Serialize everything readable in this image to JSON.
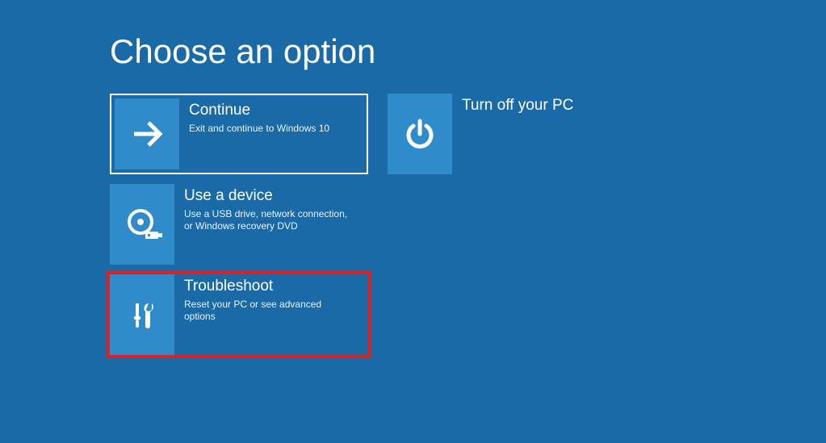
{
  "title": "Choose an option",
  "tiles": {
    "continue": {
      "title": "Continue",
      "desc": "Exit and continue to Windows 10"
    },
    "turn_off": {
      "title": "Turn off your PC",
      "desc": ""
    },
    "use_device": {
      "title": "Use a device",
      "desc": "Use a USB drive, network connection, or Windows recovery DVD"
    },
    "troubleshoot": {
      "title": "Troubleshoot",
      "desc": "Reset your PC or see advanced options"
    }
  },
  "state": {
    "selected": "continue",
    "highlighted": "troubleshoot"
  },
  "colors": {
    "background": "#1a6aa8",
    "tile_icon_bg": "#2f8bc9",
    "selection_border": "#ffffff",
    "highlight_border": "#e02020"
  }
}
